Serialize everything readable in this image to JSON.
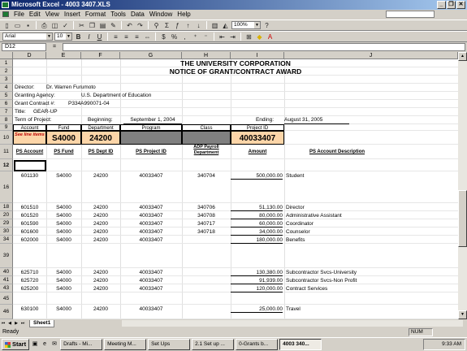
{
  "window": {
    "title": "Microsoft Excel - 4003 3407.XLS"
  },
  "menu": [
    "File",
    "Edit",
    "View",
    "Insert",
    "Format",
    "Tools",
    "Data",
    "Window",
    "Help"
  ],
  "toolbar": {
    "zoom": "100%",
    "font_name": "Arial",
    "font_size": "10"
  },
  "formula_bar": {
    "name_box": "D12",
    "fx": "="
  },
  "columns": [
    "D",
    "E",
    "F",
    "G",
    "H",
    "I",
    "J"
  ],
  "rows": [
    "1",
    "2",
    "3",
    "4",
    "5",
    "6",
    "7",
    "8",
    "9",
    "10",
    "11",
    "12",
    "16",
    "18",
    "20",
    "29",
    "30",
    "34",
    "39",
    "40",
    "41",
    "43",
    "45",
    "46"
  ],
  "sheet": {
    "title1": "THE UNIVERSITY CORPORATION",
    "title2": "NOTICE OF GRANT/CONTRACT AWARD",
    "director_label": "Director:",
    "director_value": "Dr. Warren Furumoto",
    "agency_label": "Granting Agency:",
    "agency_value": "U.S. Department of Education",
    "contract_label": "Grant Contract #:",
    "contract_value": "P334A990071-04",
    "title_label": "Title:",
    "title_value": "GEAR-UP",
    "term_label": "Term of Project:",
    "beginning_label": "Beginning:",
    "beginning_value": "September 1, 2004",
    "ending_label": "Ending:",
    "ending_value": "August 31, 2005",
    "hdr_account": "Account",
    "hdr_fund": "Fund",
    "hdr_department": "Department",
    "hdr_program": "Program",
    "hdr_class": "Class",
    "hdr_project_id": "Project ID",
    "see_line_items": "See line items",
    "fund_value": "S4000",
    "dept_value": "24200",
    "project_value": "40033407",
    "col_ps_account": "PS Account",
    "col_ps_fund": "PS Fund",
    "col_ps_dept": "PS Dept ID",
    "col_ps_project": "PS Project ID",
    "col_adp": "ADP Payroll Department",
    "col_amount": "Amount",
    "col_desc": "PS Account Description"
  },
  "line_items": [
    {
      "row": "16",
      "account": "601130",
      "fund": "S4000",
      "dept": "24200",
      "project": "40033407",
      "adp": "340704",
      "amount": "500,000.00",
      "desc": "Student"
    },
    {
      "row": "18",
      "account": "601510",
      "fund": "S4000",
      "dept": "24200",
      "project": "40033407",
      "adp": "340706",
      "amount": "51,130.00",
      "desc": "Director"
    },
    {
      "row": "20",
      "account": "601520",
      "fund": "S4000",
      "dept": "24200",
      "project": "40033407",
      "adp": "340708",
      "amount": "80,000.00",
      "desc": "Administrative Assistant"
    },
    {
      "row": "29",
      "account": "601590",
      "fund": "S4000",
      "dept": "24200",
      "project": "40033407",
      "adp": "340717",
      "amount": "60,000.00",
      "desc": "Coordinator"
    },
    {
      "row": "30",
      "account": "601600",
      "fund": "S4000",
      "dept": "24200",
      "project": "40033407",
      "adp": "340718",
      "amount": "34,000.00",
      "desc": "Counselor"
    },
    {
      "row": "34",
      "account": "602000",
      "fund": "S4000",
      "dept": "24200",
      "project": "40033407",
      "adp": "",
      "amount": "180,000.00",
      "desc": "Benefits"
    },
    {
      "row": "40",
      "account": "625710",
      "fund": "S4000",
      "dept": "24200",
      "project": "40033407",
      "adp": "",
      "amount": "130,380.00",
      "desc": "Subcontractor Svcs-University"
    },
    {
      "row": "41",
      "account": "625720",
      "fund": "S4000",
      "dept": "24200",
      "project": "40033407",
      "adp": "",
      "amount": "91,939.00",
      "desc": "Subcontractor Svcs-Non Profit"
    },
    {
      "row": "43",
      "account": "625200",
      "fund": "S4000",
      "dept": "24200",
      "project": "40033407",
      "adp": "",
      "amount": "120,000.00",
      "desc": "Contract Services"
    },
    {
      "row": "46",
      "account": "630100",
      "fund": "S4000",
      "dept": "24200",
      "project": "40033407",
      "adp": "",
      "amount": "25,000.00",
      "desc": "Travel"
    }
  ],
  "sheet_tab": "Sheet1",
  "status": {
    "ready": "Ready",
    "num": "NUM"
  },
  "taskbar": {
    "start": "Start",
    "buttons": [
      "Drafts - Mi...",
      "Meeting M...",
      "Set Ups",
      "2.1 Set up ...",
      "0-Grants b...",
      "4003 340..."
    ],
    "clock": "9:33 AM"
  },
  "colors": {
    "highlight": "#fcd5a8",
    "gray_cell": "#808080",
    "title_bar": "#0a246a"
  }
}
